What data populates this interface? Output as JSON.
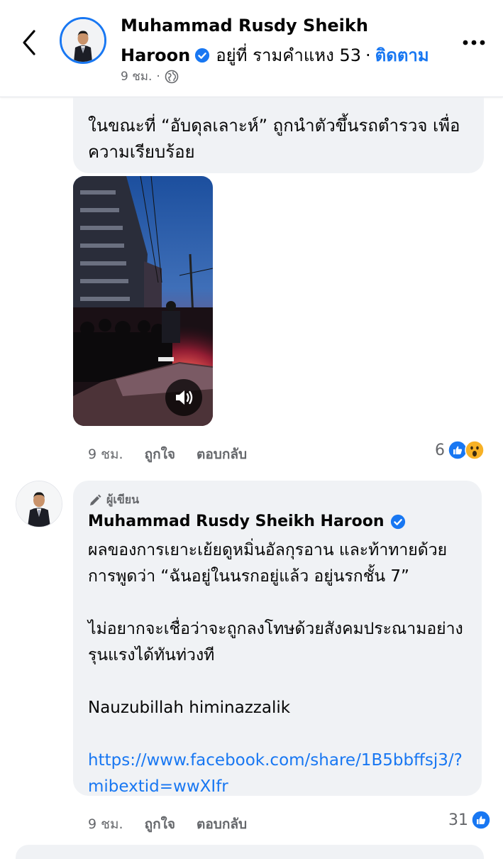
{
  "header": {
    "name_line1": "Muhammad Rusdy Sheikh",
    "name_line2": "Haroon",
    "location": "อยู่ที่ รามคำแหง 53",
    "separator": "·",
    "follow_label": "ติดตาม",
    "time": "9 ชม.",
    "meta_separator": "·"
  },
  "comment1": {
    "text": "ในขณะที่ “อับดุลเลาะห์” ถูกนำตัวขึ้นรถตำรวจ เพื่อความเรียบร้อย",
    "time": "9 ชม.",
    "like_label": "ถูกใจ",
    "reply_label": "ตอบกลับ",
    "reaction_count": "6"
  },
  "comment2": {
    "badge": "ผู้เขียน",
    "author": "Muhammad Rusdy Sheikh Haroon",
    "para1": "ผลของการเยาะเย้ยดูหมิ่นอัลกุรอาน และท้าทายด้วยการพูดว่า “ฉันอยู่ในนรกอยู่แล้ว อยู่นรกชั้น 7”",
    "para2": "ไม่อยากจะเชื่อว่าจะถูกลงโทษด้วยสังคมประณามอย่างรุนแรงได้ทันท่วงที",
    "para3": "Nauzubillah himinazzalik",
    "link": "https://www.facebook.com/share/1B5bbffsj3/?mibextid=wwXIfr",
    "time": "9 ชม.",
    "like_label": "ถูกใจ",
    "reply_label": "ตอบกลับ",
    "reaction_count": "31"
  },
  "colors": {
    "accent": "#1877f2",
    "bubble": "#f0f2f5",
    "muted": "#65676b"
  }
}
